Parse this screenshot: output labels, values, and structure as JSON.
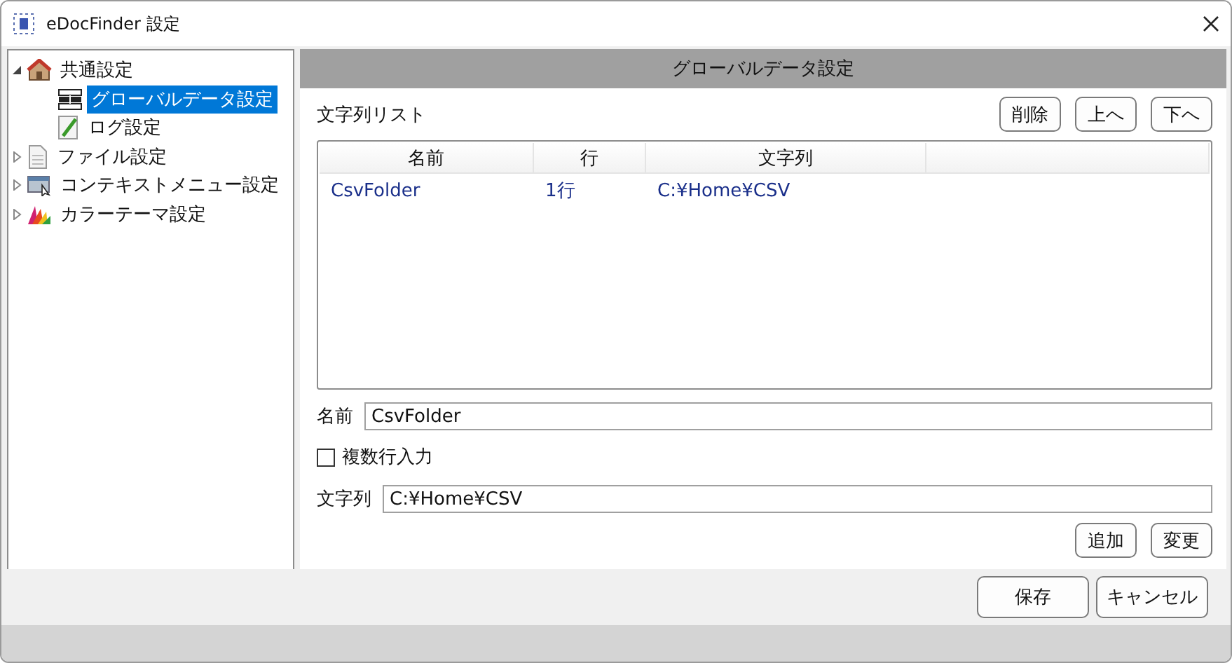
{
  "window": {
    "title": "eDocFinder 設定"
  },
  "tree": [
    {
      "label": "共通設定",
      "expanded": true,
      "selected": false,
      "children": [
        {
          "label": "グローバルデータ設定",
          "selected": true
        },
        {
          "label": "ログ設定",
          "selected": false
        }
      ]
    },
    {
      "label": "ファイル設定",
      "expanded": false,
      "selected": false
    },
    {
      "label": "コンテキストメニュー設定",
      "expanded": false,
      "selected": false
    },
    {
      "label": "カラーテーマ設定",
      "expanded": false,
      "selected": false
    }
  ],
  "panel": {
    "title": "グローバルデータ設定",
    "list_label": "文字列リスト",
    "list_buttons": [
      "削除",
      "上へ",
      "下へ"
    ],
    "table": {
      "columns": [
        "名前",
        "行",
        "文字列"
      ],
      "rows": [
        [
          "CsvFolder",
          "1行",
          "C:¥Home¥CSV"
        ]
      ]
    },
    "name_label": "名前",
    "name_value": "CsvFolder",
    "multiline": {
      "label": "複数行入力",
      "checked": false
    },
    "string_label": "文字列",
    "string_value": "C:¥Home¥CSV",
    "edit_buttons": [
      "追加",
      "変更"
    ]
  },
  "footer_buttons": [
    "保存",
    "キャンセル"
  ]
}
